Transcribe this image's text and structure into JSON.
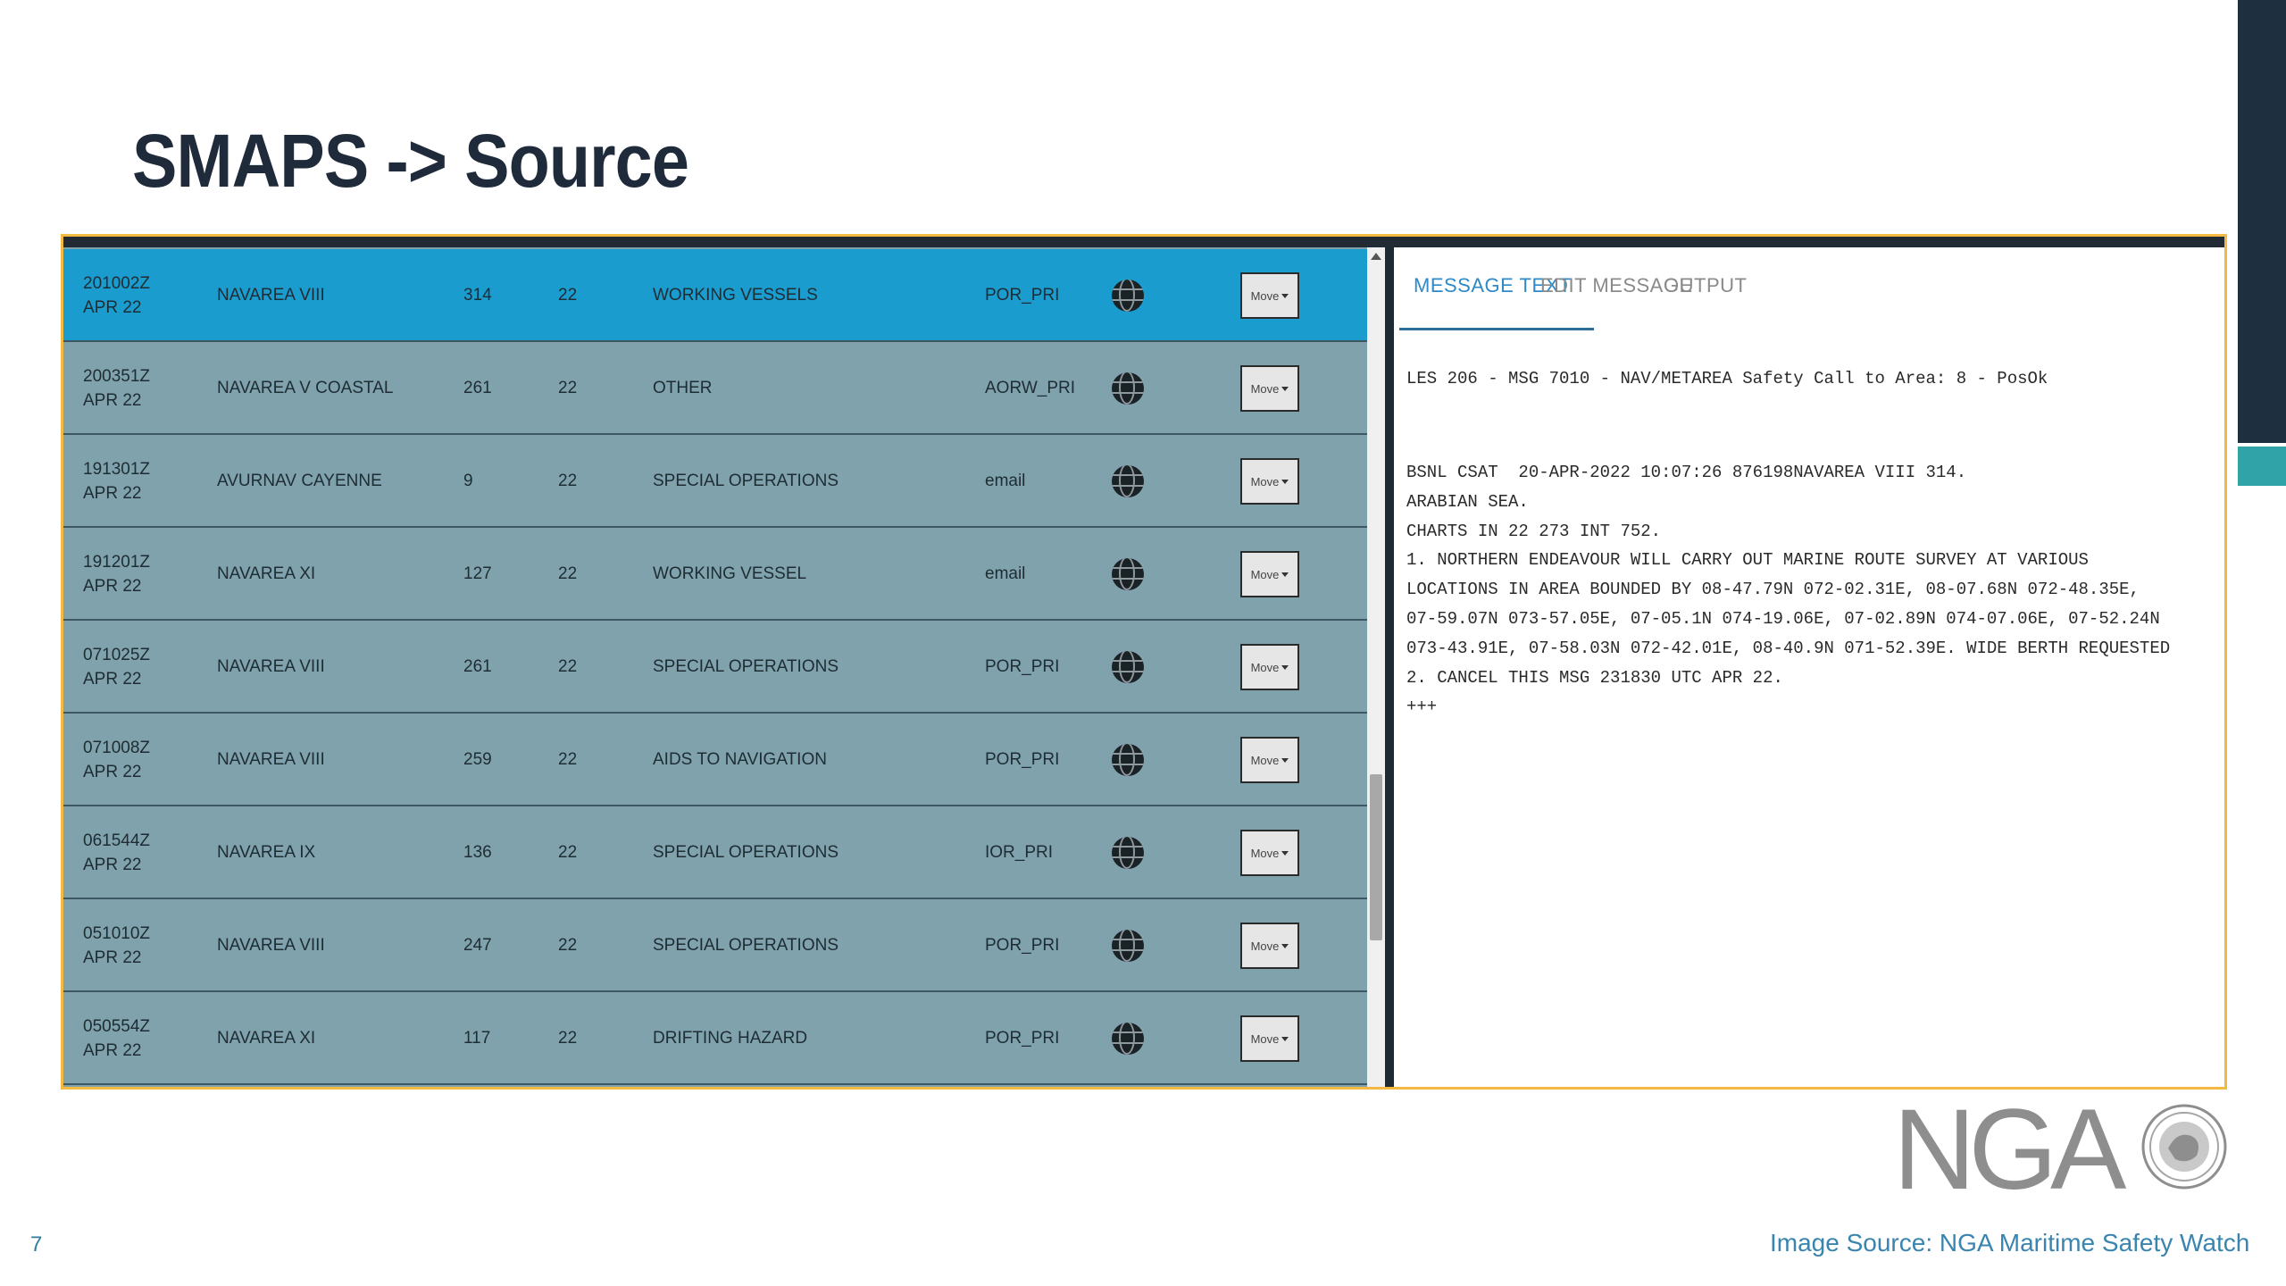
{
  "slide": {
    "title": "SMAPS -> Source",
    "number": "7",
    "source": "Image Source: NGA Maritime Safety Watch",
    "logo_text": "NGA"
  },
  "table": {
    "rows": [
      {
        "dtg": "201002Z",
        "date": "APR 22",
        "area": "NAVAREA VIII",
        "number": "314",
        "year": "22",
        "subject": "WORKING VESSELS",
        "authority": "POR_PRI",
        "move": "Move",
        "selected": true
      },
      {
        "dtg": "200351Z",
        "date": "APR 22",
        "area": "NAVAREA V COASTAL",
        "number": "261",
        "year": "22",
        "subject": "OTHER",
        "authority": "AORW_PRI",
        "move": "Move",
        "selected": false
      },
      {
        "dtg": "191301Z",
        "date": "APR 22",
        "area": "AVURNAV CAYENNE",
        "number": "9",
        "year": "22",
        "subject": "SPECIAL OPERATIONS",
        "authority": "email",
        "move": "Move",
        "selected": false
      },
      {
        "dtg": "191201Z",
        "date": "APR 22",
        "area": "NAVAREA XI",
        "number": "127",
        "year": "22",
        "subject": "WORKING VESSEL",
        "authority": "email",
        "move": "Move",
        "selected": false
      },
      {
        "dtg": "071025Z",
        "date": "APR 22",
        "area": "NAVAREA VIII",
        "number": "261",
        "year": "22",
        "subject": "SPECIAL OPERATIONS",
        "authority": "POR_PRI",
        "move": "Move",
        "selected": false
      },
      {
        "dtg": "071008Z",
        "date": "APR 22",
        "area": "NAVAREA VIII",
        "number": "259",
        "year": "22",
        "subject": "AIDS TO NAVIGATION",
        "authority": "POR_PRI",
        "move": "Move",
        "selected": false
      },
      {
        "dtg": "061544Z",
        "date": "APR 22",
        "area": "NAVAREA IX",
        "number": "136",
        "year": "22",
        "subject": "SPECIAL OPERATIONS",
        "authority": "IOR_PRI",
        "move": "Move",
        "selected": false
      },
      {
        "dtg": "051010Z",
        "date": "APR 22",
        "area": "NAVAREA VIII",
        "number": "247",
        "year": "22",
        "subject": "SPECIAL OPERATIONS",
        "authority": "POR_PRI",
        "move": "Move",
        "selected": false
      },
      {
        "dtg": "050554Z",
        "date": "APR 22",
        "area": "NAVAREA XI",
        "number": "117",
        "year": "22",
        "subject": "DRIFTING HAZARD",
        "authority": "POR_PRI",
        "move": "Move",
        "selected": false
      }
    ]
  },
  "message_panel": {
    "tabs": [
      {
        "label": "MESSAGE TEXT",
        "active": true
      },
      {
        "label": "EDIT MESSAGE",
        "active": false
      },
      {
        "label": "OUTPUT",
        "active": false
      }
    ],
    "header": "LES 206 - MSG 7010 - NAV/METAREA Safety Call to Area: 8 - PosOk",
    "body_lines": [
      "BSNL CSAT  20-APR-2022 10:07:26 876198NAVAREA VIII 314.",
      "ARABIAN SEA.",
      "CHARTS IN 22 273 INT 752.",
      "1. NORTHERN ENDEAVOUR WILL CARRY OUT MARINE ROUTE SURVEY AT VARIOUS",
      "LOCATIONS IN AREA BOUNDED BY 08-47.79N 072-02.31E, 08-07.68N 072-48.35E,",
      "07-59.07N 073-57.05E, 07-05.1N 074-19.06E, 07-02.89N 074-07.06E, 07-52.24N",
      "073-43.91E, 07-58.03N 072-42.01E, 08-40.9N 071-52.39E. WIDE BERTH REQUESTED",
      "2. CANCEL THIS MSG 231830 UTC APR 22.",
      "+++"
    ]
  },
  "colors": {
    "table_bg": "#7fa2ad",
    "selected_row": "#1a9ccf",
    "panel_border": "#f4b940",
    "active_tab": "#2d8ac7",
    "title": "#1f2b3a"
  },
  "icons": {
    "row_globe": "globe-icon",
    "move_caret": "caret-down-icon",
    "scroll_up": "scroll-up-arrow-icon"
  }
}
